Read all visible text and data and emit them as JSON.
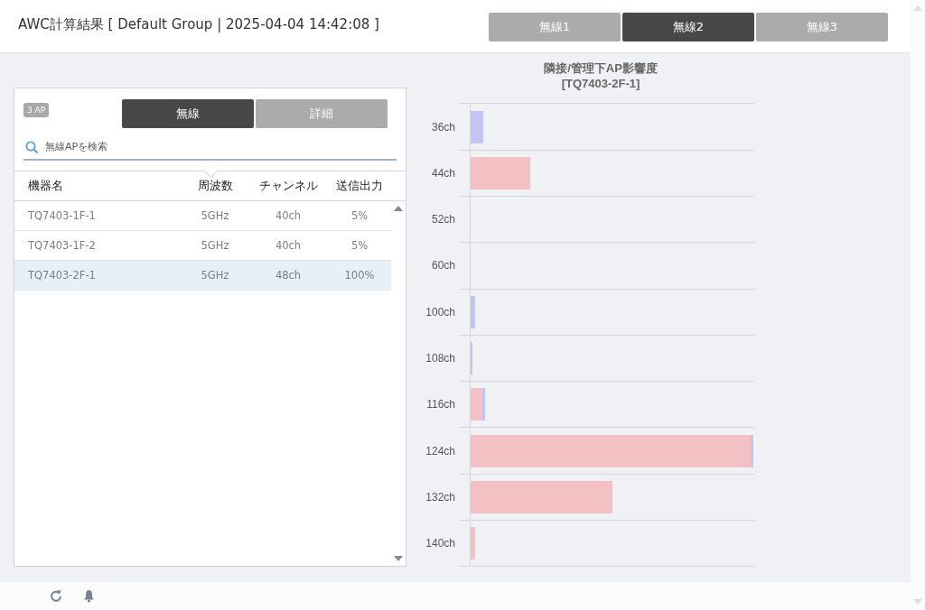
{
  "header": {
    "title": "AWC計算結果 [ Default Group | 2025-04-04 14:42:08 ]",
    "tabs": [
      {
        "label": "無線1",
        "selected": false
      },
      {
        "label": "無線2",
        "selected": true
      },
      {
        "label": "無線3",
        "selected": false
      }
    ]
  },
  "panel": {
    "badge": "3 AP",
    "tabs": [
      {
        "label": "無線",
        "selected": true
      },
      {
        "label": "詳細",
        "selected": false
      }
    ],
    "search": {
      "placeholder": "無線APを検索"
    },
    "table": {
      "columns": [
        "機器名",
        "周波数",
        "チャンネル",
        "送信出力"
      ],
      "rows": [
        {
          "cells": [
            "TQ7403-1F-1",
            "5GHz",
            "40ch",
            "5%"
          ],
          "selected": false
        },
        {
          "cells": [
            "TQ7403-1F-2",
            "5GHz",
            "40ch",
            "5%"
          ],
          "selected": false
        },
        {
          "cells": [
            "TQ7403-2F-1",
            "5GHz",
            "48ch",
            "100%"
          ],
          "selected": true
        }
      ]
    }
  },
  "chart": {
    "title": [
      "隣接/管理下AP影響度",
      "[TQ7403-2F-1]"
    ],
    "categories": [
      "36ch",
      "44ch",
      "52ch",
      "60ch",
      "100ch",
      "108ch",
      "116ch",
      "124ch",
      "132ch",
      "140ch"
    ]
  }
}
